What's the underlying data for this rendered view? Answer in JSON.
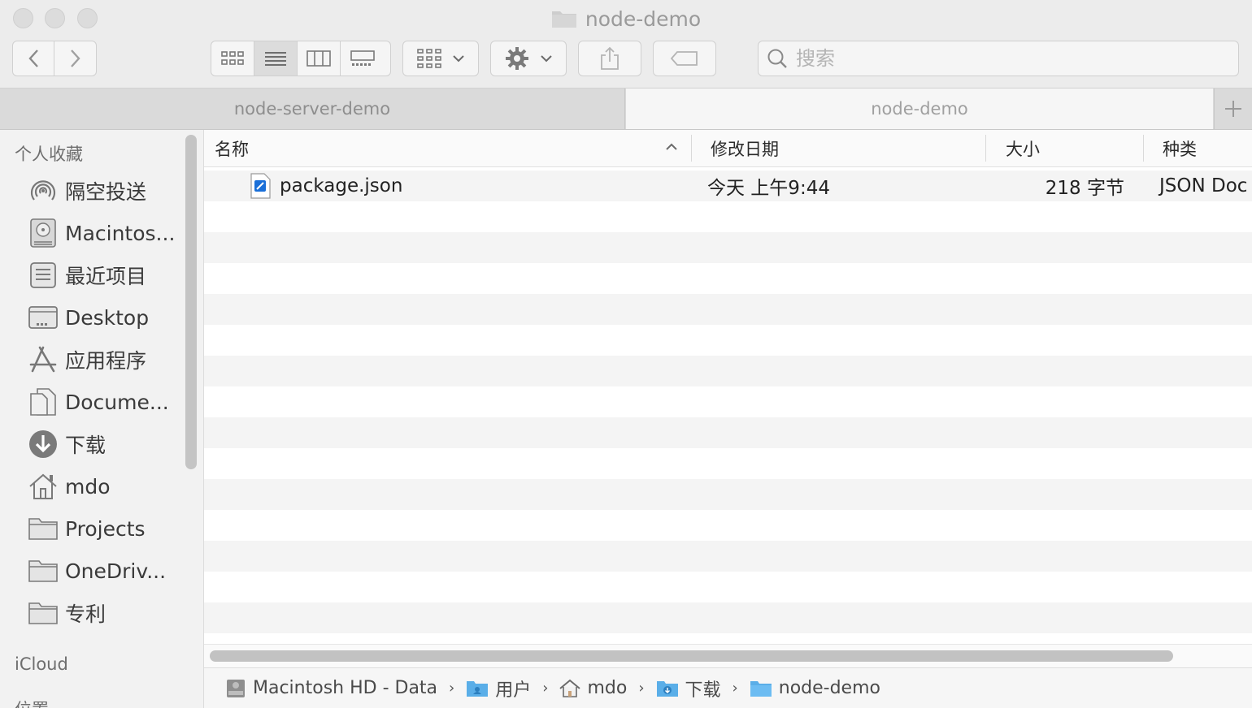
{
  "window": {
    "title": "node-demo"
  },
  "toolbar": {
    "search_placeholder": "搜索"
  },
  "tabs": [
    {
      "label": "node-server-demo"
    },
    {
      "label": "node-demo"
    }
  ],
  "sidebar": {
    "favorites_header": "个人收藏",
    "items": [
      {
        "label": "隔空投送",
        "icon": "airdrop-icon"
      },
      {
        "label": "Macintos...",
        "icon": "hard-drive-icon"
      },
      {
        "label": "最近项目",
        "icon": "recents-icon"
      },
      {
        "label": "Desktop",
        "icon": "desktop-icon"
      },
      {
        "label": "应用程序",
        "icon": "applications-icon"
      },
      {
        "label": "Docume...",
        "icon": "document-icon"
      },
      {
        "label": "下载",
        "icon": "download-icon"
      },
      {
        "label": "mdo",
        "icon": "home-icon"
      },
      {
        "label": "Projects",
        "icon": "folder-icon"
      },
      {
        "label": "OneDriv...",
        "icon": "folder-icon"
      },
      {
        "label": "专利",
        "icon": "folder-icon"
      }
    ],
    "icloud_header": "iCloud",
    "locations_header": "位置"
  },
  "columns": {
    "name": "名称",
    "modified": "修改日期",
    "size": "大小",
    "kind": "种类"
  },
  "files": [
    {
      "name": "package.json",
      "modified": "今天 上午9:44",
      "size": "218 字节",
      "kind": "JSON Doc"
    }
  ],
  "pathbar": [
    {
      "label": "Macintosh HD - Data",
      "icon": "hard-drive-icon"
    },
    {
      "label": "用户",
      "icon": "users-folder-icon"
    },
    {
      "label": "mdo",
      "icon": "home-icon"
    },
    {
      "label": "下载",
      "icon": "downloads-folder-icon"
    },
    {
      "label": "node-demo",
      "icon": "folder-icon"
    }
  ],
  "colors": {
    "folder_blue": "#5aaee8",
    "accent": "#1a6fd8"
  }
}
